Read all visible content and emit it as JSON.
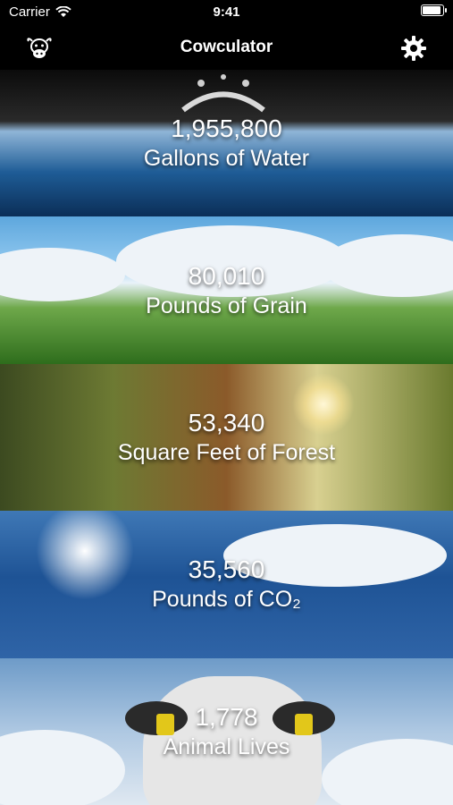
{
  "status_bar": {
    "carrier": "Carrier",
    "time": "9:41"
  },
  "nav": {
    "title": "Cowculator",
    "left_icon": "cow-icon",
    "right_icon": "gear-icon"
  },
  "tiles": [
    {
      "value": "1,955,800",
      "label": "Gallons of Water"
    },
    {
      "value": "80,010",
      "label": "Pounds of Grain"
    },
    {
      "value": "53,340",
      "label": "Square Feet of Forest"
    },
    {
      "value": "35,560",
      "label": "Pounds of CO₂"
    },
    {
      "value": "1,778",
      "label": "Animal Lives"
    }
  ]
}
